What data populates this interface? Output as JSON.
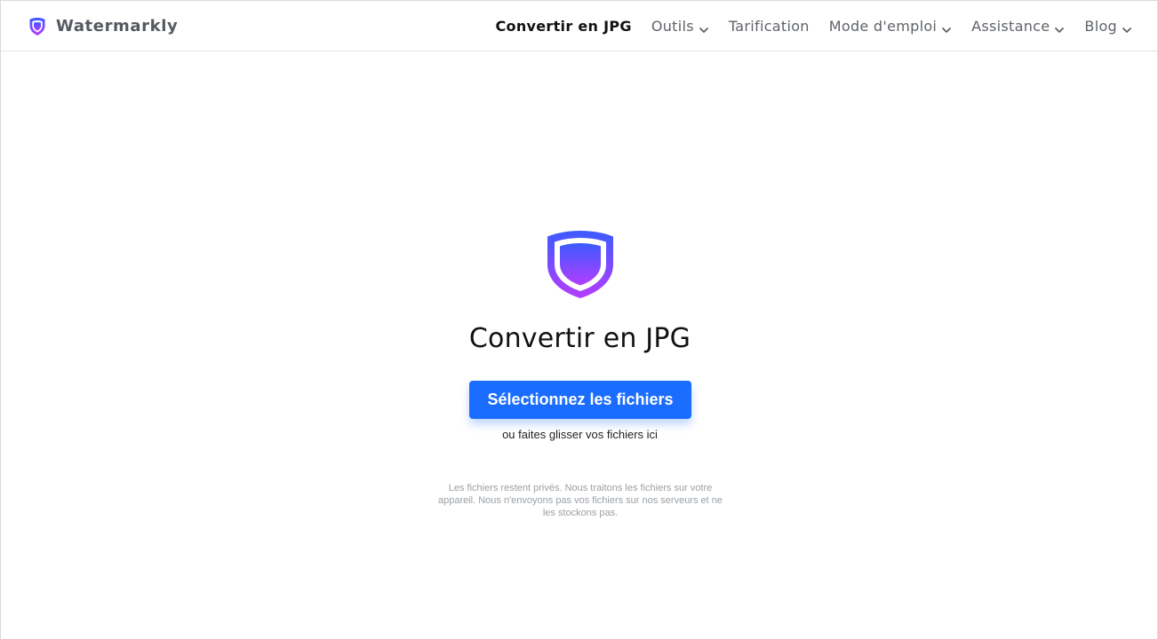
{
  "header": {
    "brand_name": "Watermarkly",
    "nav": [
      {
        "label": "Convertir en JPG",
        "active": true,
        "dropdown": false
      },
      {
        "label": "Outils",
        "active": false,
        "dropdown": true
      },
      {
        "label": "Tarification",
        "active": false,
        "dropdown": false
      },
      {
        "label": "Mode d'emploi",
        "active": false,
        "dropdown": true
      },
      {
        "label": "Assistance",
        "active": false,
        "dropdown": true
      },
      {
        "label": "Blog",
        "active": false,
        "dropdown": true
      }
    ]
  },
  "main": {
    "icon": "shield-icon",
    "title": "Convertir en JPG",
    "select_button_label": "Sélectionnez les fichiers",
    "drop_hint": "ou faites glisser vos fichiers ici",
    "privacy_note": "Les fichiers restent privés. Nous traitons les fichiers sur votre appareil. Nous n'envoyons pas vos fichiers sur nos serveurs et ne les stockons pas."
  },
  "colors": {
    "accent_button": "#1a6dff",
    "shield_gradient_top": "#3c5bff",
    "shield_gradient_bottom": "#b43dff",
    "nav_text": "#5f6368",
    "nav_active_text": "#121212",
    "privacy_text": "#9aa0a6"
  }
}
